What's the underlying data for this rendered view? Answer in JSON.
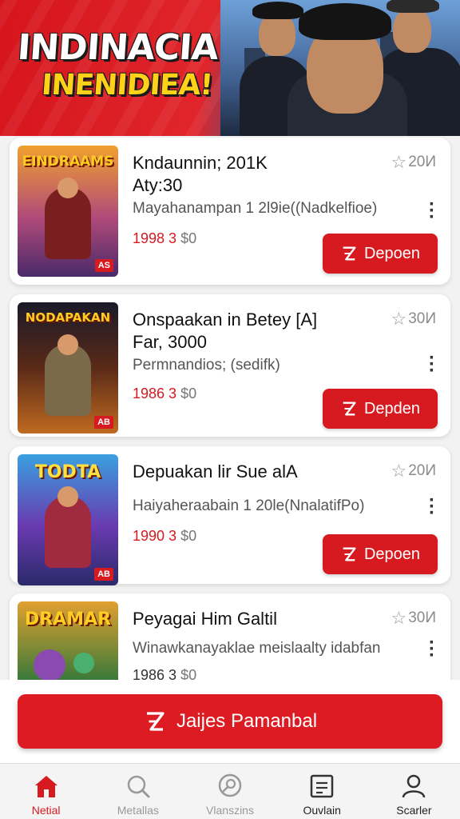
{
  "banner": {
    "title_line1": "INDINACIA",
    "title_line2": "INENIDIEA!"
  },
  "cards": [
    {
      "thumb_title": "EINDRAAMS",
      "age_badge": "AS",
      "title": "Kndaunnin; 201K\nAty:30",
      "rating": "20И",
      "subtitle": "Mayahanampan 1 2l9ie((Nadkelfioe)",
      "price_red": "1998 3",
      "price_gray": "$0",
      "cta_label": "Depoen"
    },
    {
      "thumb_title": "NODAPAKAN",
      "age_badge": "AB",
      "title": "Onspaakan in Betey [A]\nFar, 3000",
      "rating": "30И",
      "subtitle": "Permnandios; (sedifk)",
      "price_red": "1986 3",
      "price_gray": "$0",
      "cta_label": "Depden"
    },
    {
      "thumb_title": "TODTA",
      "age_badge": "AB",
      "title": "Depuakan lir Sue alA",
      "rating": "20И",
      "subtitle": "Haiyaheraabain 1 20le(NnalatifPo)",
      "price_red": "1990 3",
      "price_gray": "$0",
      "cta_label": "Depoen"
    },
    {
      "thumb_title": "DRAMAR",
      "age_badge": "",
      "title": "Peyagai Him Galtil",
      "rating": "30И",
      "subtitle": "Winawkanayaklae meislaalty idabfan",
      "price_red": "1986 3",
      "price_gray": "$0",
      "cta_label": ""
    }
  ],
  "big_button_label": "Jaijes Pamanbal",
  "tabs": [
    {
      "label": "Netial",
      "icon": "home-icon"
    },
    {
      "label": "Metallas",
      "icon": "search-icon"
    },
    {
      "label": "Vlanszins",
      "icon": "chat-search-icon"
    },
    {
      "label": "Ouvlain",
      "icon": "document-icon"
    },
    {
      "label": "Scarler",
      "icon": "profile-icon"
    }
  ],
  "colors": {
    "accent": "#d71920",
    "banner_yellow": "#ffd21a"
  }
}
